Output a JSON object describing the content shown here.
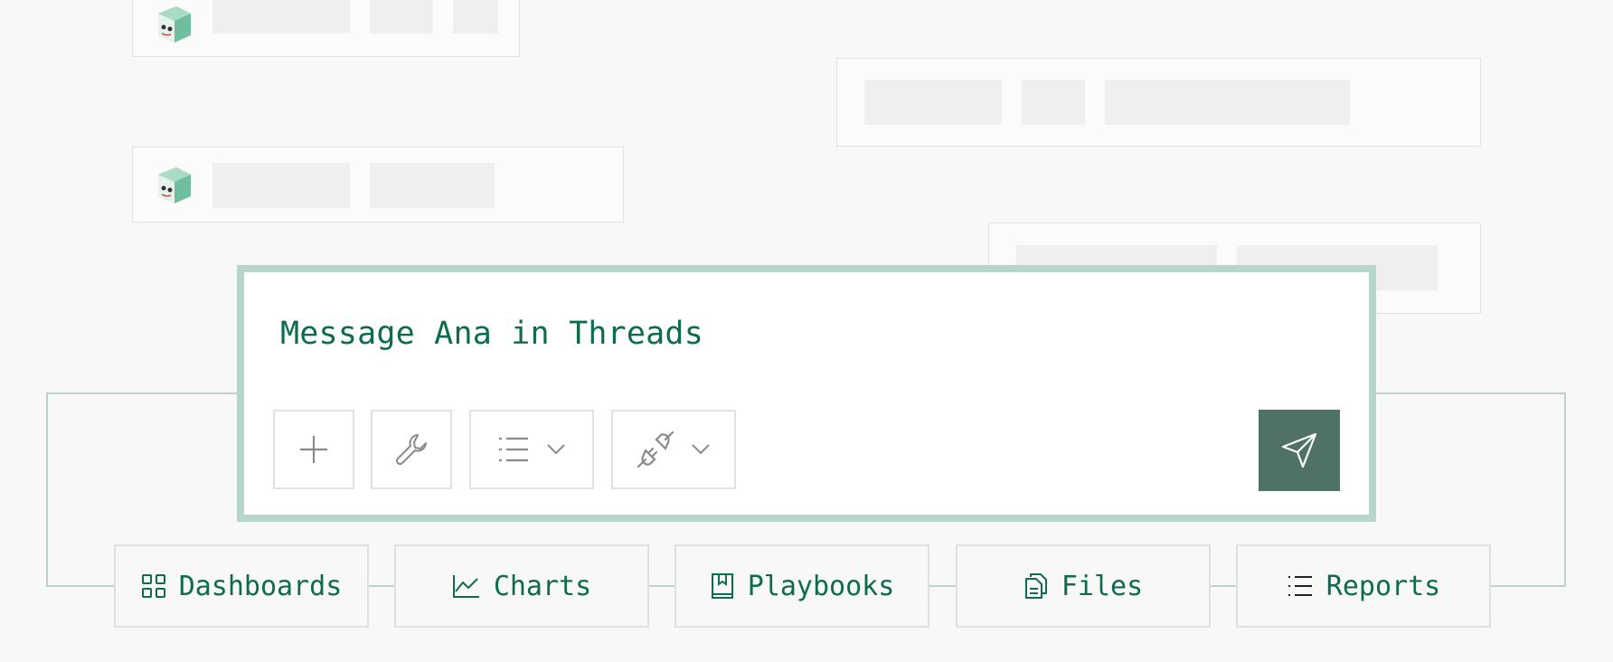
{
  "composer": {
    "placeholder": "Message Ana in Threads"
  },
  "toolbar": {
    "add_icon": "plus-icon",
    "tools_icon": "wrench-icon",
    "format_icon": "list-icon",
    "plugin_icon": "plug-icon",
    "send_icon": "send-icon"
  },
  "nav": {
    "items": [
      {
        "label": "Dashboards",
        "icon": "grid-icon"
      },
      {
        "label": "Charts",
        "icon": "line-chart-icon"
      },
      {
        "label": "Playbooks",
        "icon": "book-icon"
      },
      {
        "label": "Files",
        "icon": "files-icon"
      },
      {
        "label": "Reports",
        "icon": "list-icon"
      }
    ]
  },
  "colors": {
    "accent": "#0d6b4f",
    "send_bg": "#4f7166",
    "composer_border": "#b5d6c9"
  }
}
